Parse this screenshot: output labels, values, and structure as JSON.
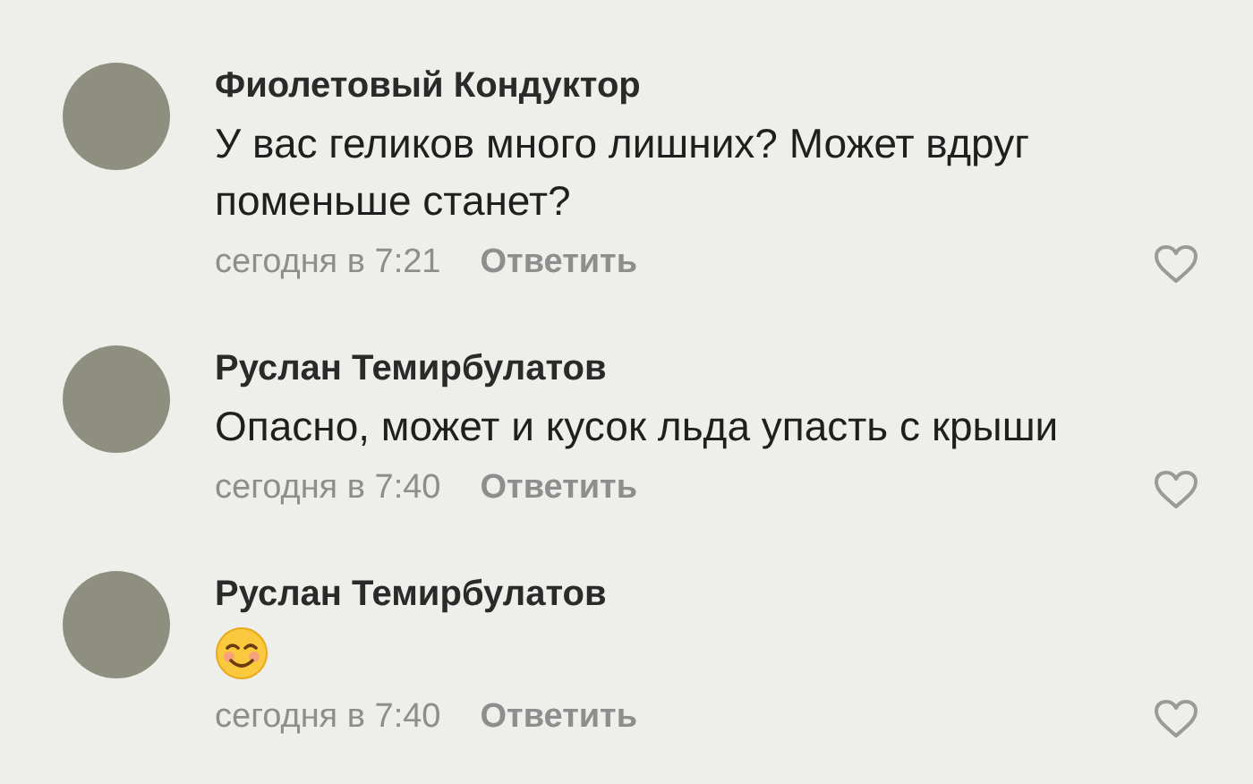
{
  "comments": [
    {
      "author": "Фиолетовый Кондуктор",
      "kind": "text",
      "text": "У вас геликов много лишних? Может вдруг поменьше станет?",
      "time": "сегодня в 7:21",
      "reply": "Ответить",
      "liked": false
    },
    {
      "author": "Руслан Темирбулатов",
      "kind": "text",
      "text": "Опасно, может и кусок льда упасть с крыши",
      "time": "сегодня в 7:40",
      "reply": "Ответить",
      "liked": false
    },
    {
      "author": "Руслан Темирбулатов",
      "kind": "emoji",
      "time": "сегодня в 7:40",
      "reply": "Ответить",
      "liked": false
    }
  ]
}
